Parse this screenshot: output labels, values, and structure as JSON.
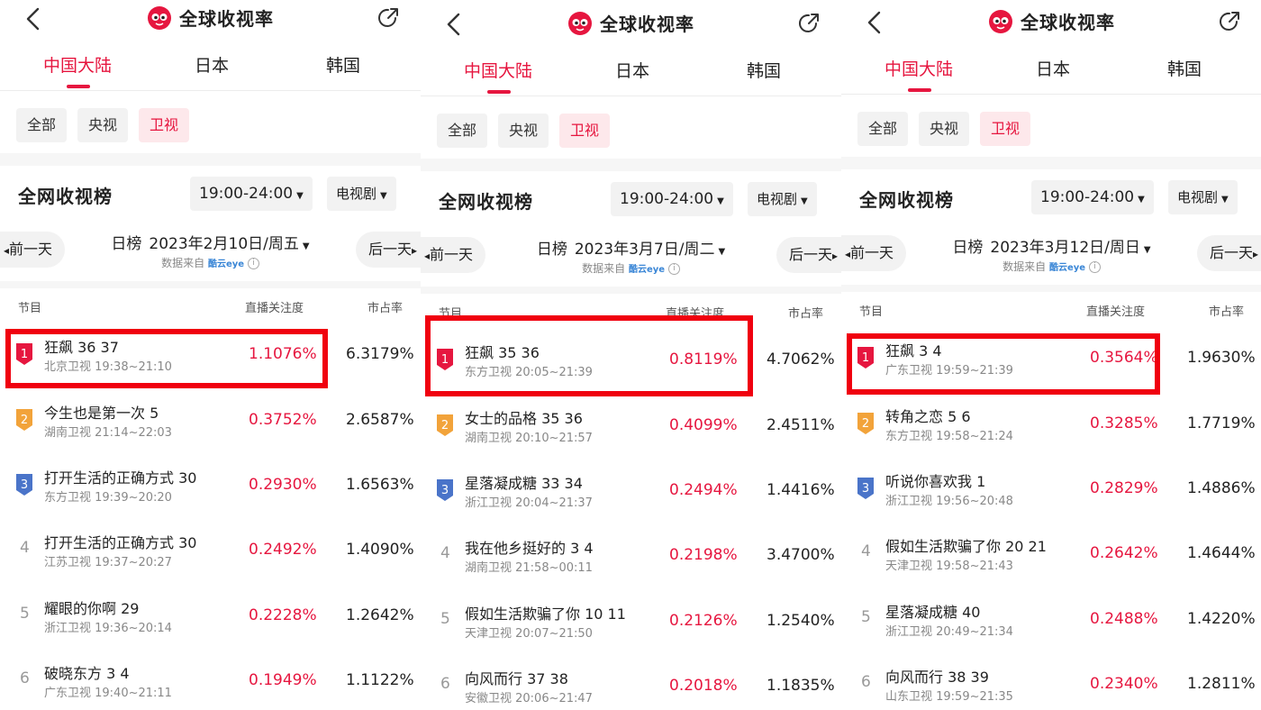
{
  "app_title": "全球收视率",
  "region_tabs": [
    "中国大陆",
    "日本",
    "韩国"
  ],
  "channel_pills": [
    "全部",
    "央视",
    "卫视"
  ],
  "active_pill": "卫视",
  "section_title": "全网收视榜",
  "table_headers": {
    "program": "节目",
    "attention": "直播关注度",
    "share": "市占率"
  },
  "source_label": "数据来自",
  "source_brand": "酷云eye",
  "day_label": "日榜",
  "prev_day": "前一天",
  "next_day": "后一天",
  "colors": {
    "accent": "#e6163f",
    "highlight_box": "#f0000f",
    "badge_gold": "#f2a33a",
    "badge_blue": "#4a74c9"
  },
  "icons": [
    "back-chevron-icon",
    "app-logo-icon",
    "share-icon",
    "caret-down-icon",
    "info-icon",
    "rank-badge-icon"
  ],
  "panels": [
    {
      "time_slot": "19:00-24:00",
      "genre": "电视剧",
      "date": "2023年2月10日/周五",
      "rows": [
        {
          "rank": "1",
          "name": "狂飙 36 37",
          "channel_time": "北京卫视 19:38~21:10",
          "attention": "1.1076%",
          "share": "6.3179%"
        },
        {
          "rank": "2",
          "name": "今生也是第一次 5",
          "channel_time": "湖南卫视 21:14~22:03",
          "attention": "0.3752%",
          "share": "2.6587%"
        },
        {
          "rank": "3",
          "name": "打开生活的正确方式 30",
          "channel_time": "东方卫视 19:39~20:20",
          "attention": "0.2930%",
          "share": "1.6563%"
        },
        {
          "rank": "4",
          "name": "打开生活的正确方式 30",
          "channel_time": "江苏卫视 19:37~20:27",
          "attention": "0.2492%",
          "share": "1.4090%"
        },
        {
          "rank": "5",
          "name": "耀眼的你啊 29",
          "channel_time": "浙江卫视 19:36~20:14",
          "attention": "0.2228%",
          "share": "1.2642%"
        },
        {
          "rank": "6",
          "name": "破晓东方 3 4",
          "channel_time": "广东卫视 19:40~21:11",
          "attention": "0.1949%",
          "share": "1.1122%"
        }
      ]
    },
    {
      "time_slot": "19:00-24:00",
      "genre": "电视剧",
      "date": "2023年3月7日/周二",
      "rows": [
        {
          "rank": "1",
          "name": "狂飙 35 36",
          "channel_time": "东方卫视 20:05~21:39",
          "attention": "0.8119%",
          "share": "4.7062%"
        },
        {
          "rank": "2",
          "name": "女士的品格 35 36",
          "channel_time": "湖南卫视 20:10~21:57",
          "attention": "0.4099%",
          "share": "2.4511%"
        },
        {
          "rank": "3",
          "name": "星落凝成糖 33 34",
          "channel_time": "浙江卫视 20:04~21:37",
          "attention": "0.2494%",
          "share": "1.4416%"
        },
        {
          "rank": "4",
          "name": "我在他乡挺好的 3 4",
          "channel_time": "湖南卫视 21:58~00:11",
          "attention": "0.2198%",
          "share": "3.4700%"
        },
        {
          "rank": "5",
          "name": "假如生活欺骗了你 10 11",
          "channel_time": "天津卫视 20:07~21:50",
          "attention": "0.2126%",
          "share": "1.2540%"
        },
        {
          "rank": "6",
          "name": "向风而行 37 38",
          "channel_time": "安徽卫视 20:06~21:47",
          "attention": "0.2018%",
          "share": "1.1835%"
        }
      ]
    },
    {
      "time_slot": "19:00-24:00",
      "genre": "电视剧",
      "date": "2023年3月12日/周日",
      "rows": [
        {
          "rank": "1",
          "name": "狂飙 3 4",
          "channel_time": "广东卫视 19:59~21:39",
          "attention": "0.3564%",
          "share": "1.9630%"
        },
        {
          "rank": "2",
          "name": "转角之恋 5 6",
          "channel_time": "东方卫视 19:58~21:24",
          "attention": "0.3285%",
          "share": "1.7719%"
        },
        {
          "rank": "3",
          "name": "听说你喜欢我 1",
          "channel_time": "浙江卫视 19:56~20:48",
          "attention": "0.2829%",
          "share": "1.4886%"
        },
        {
          "rank": "4",
          "name": "假如生活欺骗了你 20 21",
          "channel_time": "天津卫视 19:58~21:43",
          "attention": "0.2642%",
          "share": "1.4644%"
        },
        {
          "rank": "5",
          "name": "星落凝成糖 40",
          "channel_time": "浙江卫视 20:49~21:34",
          "attention": "0.2488%",
          "share": "1.4220%"
        },
        {
          "rank": "6",
          "name": "向风而行 38 39",
          "channel_time": "山东卫视 19:59~21:35",
          "attention": "0.2340%",
          "share": "1.2811%"
        }
      ]
    }
  ]
}
